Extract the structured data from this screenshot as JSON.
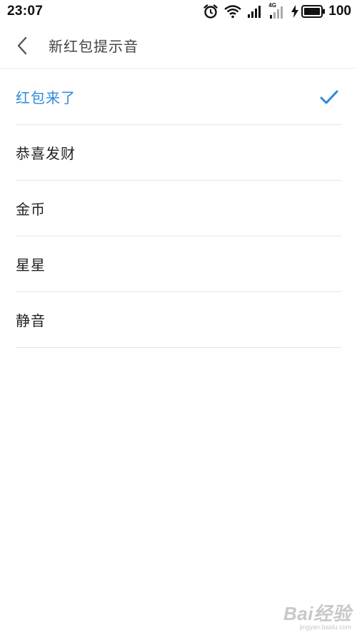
{
  "status_bar": {
    "time": "23:07",
    "network_label": "4G",
    "battery": "100"
  },
  "header": {
    "title": "新红包提示音"
  },
  "options": [
    {
      "label": "红包来了",
      "selected": true
    },
    {
      "label": "恭喜发财",
      "selected": false
    },
    {
      "label": "金币",
      "selected": false
    },
    {
      "label": "星星",
      "selected": false
    },
    {
      "label": "静音",
      "selected": false
    }
  ],
  "watermark": {
    "logo": "Bai经验",
    "url": "jingyan.baidu.com"
  },
  "colors": {
    "accent": "#2f8ad8",
    "text": "#222222",
    "divider": "#e6e6e6"
  }
}
